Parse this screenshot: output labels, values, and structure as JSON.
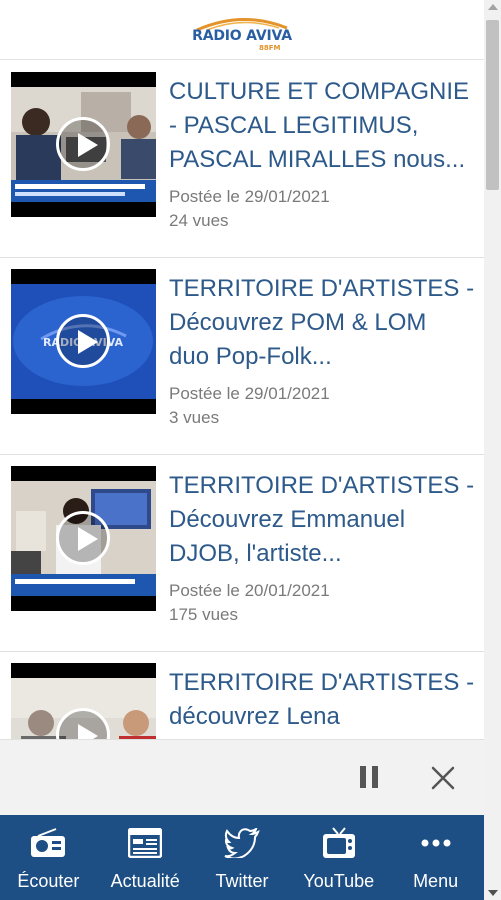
{
  "app": {
    "logo_text": "RADIO AVIVA",
    "logo_sub": "88FM"
  },
  "videos": [
    {
      "title_lines": [
        "CULTURE ET COMPAGNIE",
        "- PASCAL LEGITIMUS,",
        "PASCAL MIRALLES nous..."
      ],
      "date": "Postée le 29/01/2021",
      "views": "24 vues"
    },
    {
      "title_lines": [
        "TERRITOIRE D'ARTISTES -",
        "Découvrez POM & LOM",
        "duo Pop-Folk..."
      ],
      "date": "Postée le 29/01/2021",
      "views": "3 vues"
    },
    {
      "title_lines": [
        "TERRITOIRE D'ARTISTES -",
        "Découvrez Emmanuel",
        "DJOB, l'artiste..."
      ],
      "date": "Postée le 20/01/2021",
      "views": "175 vues"
    },
    {
      "title_lines": [
        "TERRITOIRE D'ARTISTES -",
        "découvrez Lena",
        ""
      ],
      "date": "",
      "views": ""
    }
  ],
  "player": {
    "pause_icon": "pause-icon",
    "close_icon": "close-icon"
  },
  "tabs": [
    {
      "label": "Écouter",
      "icon": "radio-icon"
    },
    {
      "label": "Actualité",
      "icon": "news-icon"
    },
    {
      "label": "Twitter",
      "icon": "twitter-icon"
    },
    {
      "label": "YouTube",
      "icon": "tv-icon"
    },
    {
      "label": "Menu",
      "icon": "more-icon"
    }
  ],
  "colors": {
    "tabbar": "#1d4f84",
    "title": "#2d5a8a",
    "meta": "#7a7a7a"
  }
}
